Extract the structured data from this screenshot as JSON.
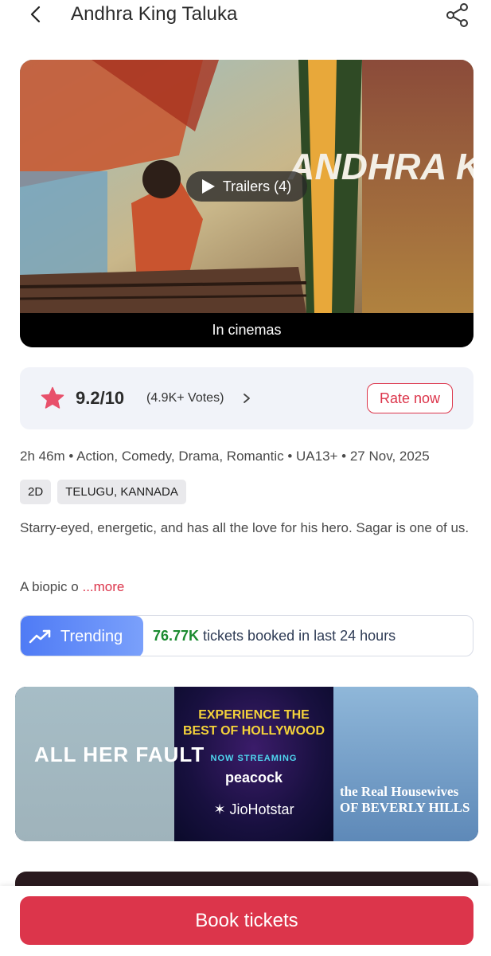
{
  "header": {
    "title": "Andhra King Taluka",
    "back_icon": "chevron-left-icon",
    "share_icon": "share-icon"
  },
  "poster": {
    "logo_text": "ANDHRA KING",
    "trailers_label": "Trailers (4)",
    "status_label": "In cinemas"
  },
  "rating": {
    "value": "9.2/10",
    "votes": "(4.9K+ Votes)",
    "rate_button": "Rate now",
    "star_color": "#e8506b"
  },
  "meta": {
    "line": "2h 46m • Action, Comedy, Drama, Romantic • UA13+ • 27 Nov, 2025",
    "tags": [
      "2D",
      "TELUGU, KANNADA"
    ]
  },
  "description": {
    "text": "Starry-eyed, energetic, and has all the love for his hero. Sagar is one of us.",
    "truncated": "A biopic o",
    "more_label": "...more"
  },
  "trending": {
    "badge_label": "Trending",
    "count": "76.77K",
    "suffix": " tickets booked in last 24 hours"
  },
  "ad": {
    "left_title": "ALL HER FAULT",
    "headline": "EXPERIENCE THE BEST OF HOLLYWOOD",
    "streaming": "NOW STREAMING",
    "brand1": "peacock",
    "brand2": "JioHotstar",
    "right_title": "the Real Housewives OF BEVERLY HILLS"
  },
  "footer": {
    "book_label": "Book tickets",
    "accent": "#dc354b"
  }
}
